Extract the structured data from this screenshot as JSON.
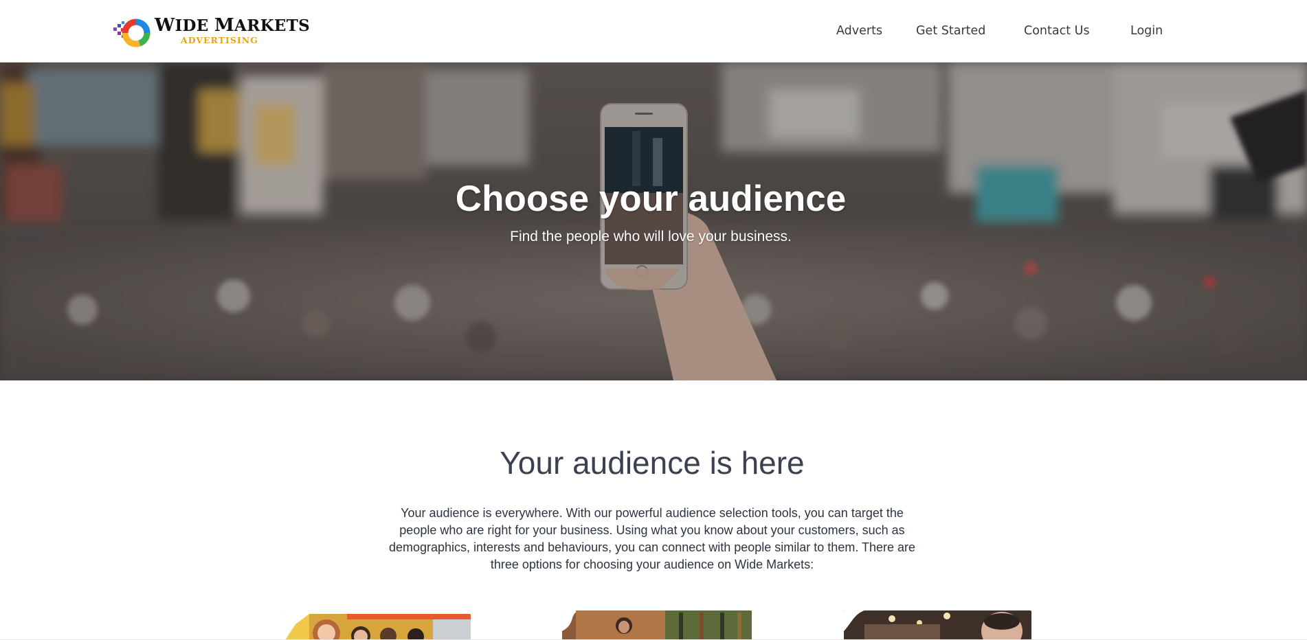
{
  "brand": {
    "name_first_letter": "W",
    "name_rest": "IDE ",
    "name_second_first_letter": "M",
    "name_second_rest": "ARKETS",
    "subtitle": "ADVERTISING",
    "colors": {
      "name": "#111111",
      "subtitle": "#e5a21a",
      "ring": [
        "#e63a2e",
        "#f7b32b",
        "#3cb44b",
        "#1e88e5",
        "#8e44ad"
      ]
    }
  },
  "nav": {
    "items": [
      {
        "label": "Adverts"
      },
      {
        "label": "Get Started"
      },
      {
        "label": "Contact Us"
      },
      {
        "label": "Login"
      }
    ]
  },
  "hero": {
    "title": "Choose your audience",
    "subtitle": "Find the people who will love your business.",
    "image_icon": "city-crowd-phone-photo"
  },
  "intro": {
    "title": "Your audience is here",
    "body": "Your audience is everywhere. With our powerful audience selection tools, you can target the people who are right for your business. Using what you know about your customers, such as demographics, interests and behaviours, you can connect with people similar to them. There are three options for choosing your audience on Wide Markets:"
  },
  "options": [
    {
      "image_icon": "people-shopping-photo"
    },
    {
      "image_icon": "market-shopper-photo"
    },
    {
      "image_icon": "restaurant-people-photo"
    }
  ],
  "colors": {
    "text_dark": "#2d3340",
    "heading": "#3b4150",
    "nav_text": "#3a3a3a"
  }
}
